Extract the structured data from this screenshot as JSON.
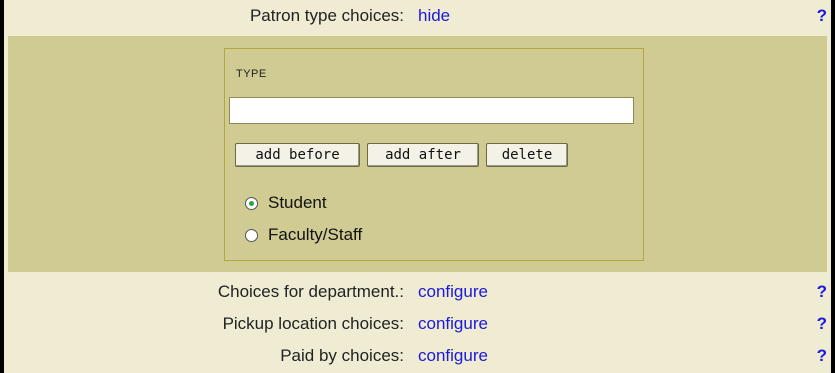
{
  "rows": {
    "patron_type": {
      "label": "Patron type choices:",
      "link": "hide",
      "help": "?"
    },
    "department": {
      "label": "Choices for department.:",
      "link": "configure",
      "help": "?"
    },
    "pickup_location": {
      "label": "Pickup location choices:",
      "link": "configure",
      "help": "?"
    },
    "paid_by": {
      "label": "Paid by choices:",
      "link": "configure",
      "help": "?"
    }
  },
  "editor": {
    "field_label": "TYPE",
    "input_value": "",
    "buttons": {
      "add_before": "add before",
      "add_after": "add after",
      "delete": "delete"
    },
    "options": [
      {
        "label": "Student",
        "selected": true
      },
      {
        "label": "Faculty/Staff",
        "selected": false
      }
    ]
  }
}
